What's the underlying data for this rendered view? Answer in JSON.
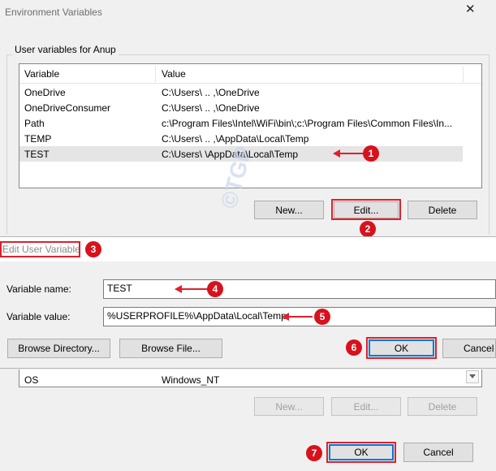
{
  "env_window": {
    "title": "Environment Variables",
    "close_glyph": "✕",
    "user_group_label": "User variables for Anup",
    "columns": [
      "Variable",
      "Value"
    ],
    "rows": [
      {
        "variable": "OneDrive",
        "value": "C:\\Users\\  ..  ,\\OneDrive"
      },
      {
        "variable": "OneDriveConsumer",
        "value": "C:\\Users\\  ..  ,\\OneDrive"
      },
      {
        "variable": "Path",
        "value": "c:\\Program Files\\Intel\\WiFi\\bin\\;c:\\Program Files\\Common Files\\In..."
      },
      {
        "variable": "TEMP",
        "value": "C:\\Users\\  ..  ,\\AppData\\Local\\Temp"
      },
      {
        "variable": "TEST",
        "value": "C:\\Users\\        \\AppData\\Local\\Temp"
      }
    ],
    "selected_row": 4,
    "buttons": {
      "new": "New...",
      "edit": "Edit...",
      "delete": "Delete"
    },
    "system_row": {
      "variable": "OS",
      "value": "Windows_NT"
    },
    "system_buttons": {
      "new": "New...",
      "edit": "Edit...",
      "delete": "Delete"
    },
    "ok": "OK",
    "cancel": "Cancel"
  },
  "edit_dialog": {
    "title": "Edit User Variable",
    "name_label": "Variable name:",
    "name_value": "TEST",
    "value_label": "Variable value:",
    "value_value": "%USERPROFILE%\\AppData\\Local\\Temp",
    "browse_directory": "Browse Directory...",
    "browse_file": "Browse File...",
    "ok": "OK",
    "cancel": "Cancel"
  },
  "callouts": [
    "1",
    "2",
    "3",
    "4",
    "5",
    "6",
    "7"
  ],
  "watermark": "©TGP",
  "colors": {
    "annotation_red": "#e0202a",
    "selection": "#e5e5e5",
    "focus_blue": "#0078d7"
  }
}
